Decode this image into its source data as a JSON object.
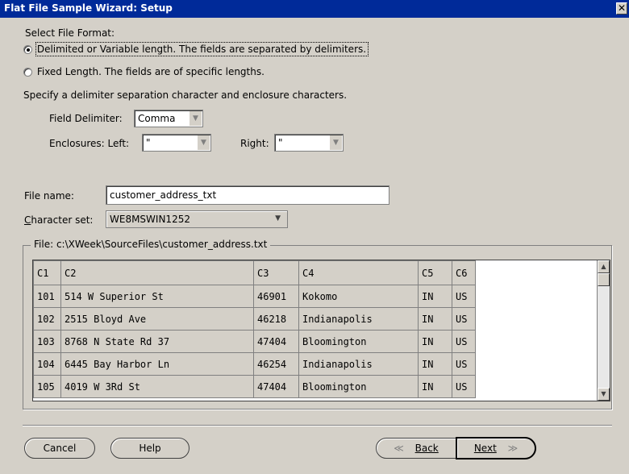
{
  "window": {
    "title": "Flat File Sample Wizard: Setup",
    "close_glyph": "✕"
  },
  "format": {
    "heading": "Select File Format:",
    "delimited_label": "Delimited or Variable length. The fields are separated by delimiters.",
    "fixed_label": "Fixed Length. The fields are of specific lengths.",
    "selected": "delimited"
  },
  "delimiters": {
    "instructions": "Specify a delimiter separation character and enclosure characters.",
    "field_delimiter_label": "Field Delimiter:",
    "field_delimiter_value": "Comma",
    "enclosures_left_label": "Enclosures: Left:",
    "enclosures_left_value": "\"",
    "right_label": "Right:",
    "right_value": "\""
  },
  "file": {
    "name_label": "File name:",
    "name_value": "customer_address_txt",
    "charset_label": "Character set:",
    "charset_value": "WE8MSWIN1252",
    "path_label": "File: c:\\XWeek\\SourceFiles\\customer_address.txt"
  },
  "grid": {
    "columns": [
      "C1",
      "C2",
      "C3",
      "C4",
      "C5",
      "C6"
    ],
    "rows": [
      [
        "101",
        "514 W Superior St",
        "46901",
        "Kokomo",
        "IN",
        "US"
      ],
      [
        "102",
        "2515 Bloyd Ave",
        "46218",
        "Indianapolis",
        "IN",
        "US"
      ],
      [
        "103",
        "8768 N State Rd 37",
        "47404",
        "Bloomington",
        "IN",
        "US"
      ],
      [
        "104",
        "6445 Bay Harbor Ln",
        "46254",
        "Indianapolis",
        "IN",
        "US"
      ],
      [
        "105",
        "4019 W 3Rd St",
        "47404",
        "Bloomington",
        "IN",
        "US"
      ]
    ]
  },
  "buttons": {
    "cancel": "Cancel",
    "help": "Help",
    "back": "Back",
    "next": "Next"
  }
}
